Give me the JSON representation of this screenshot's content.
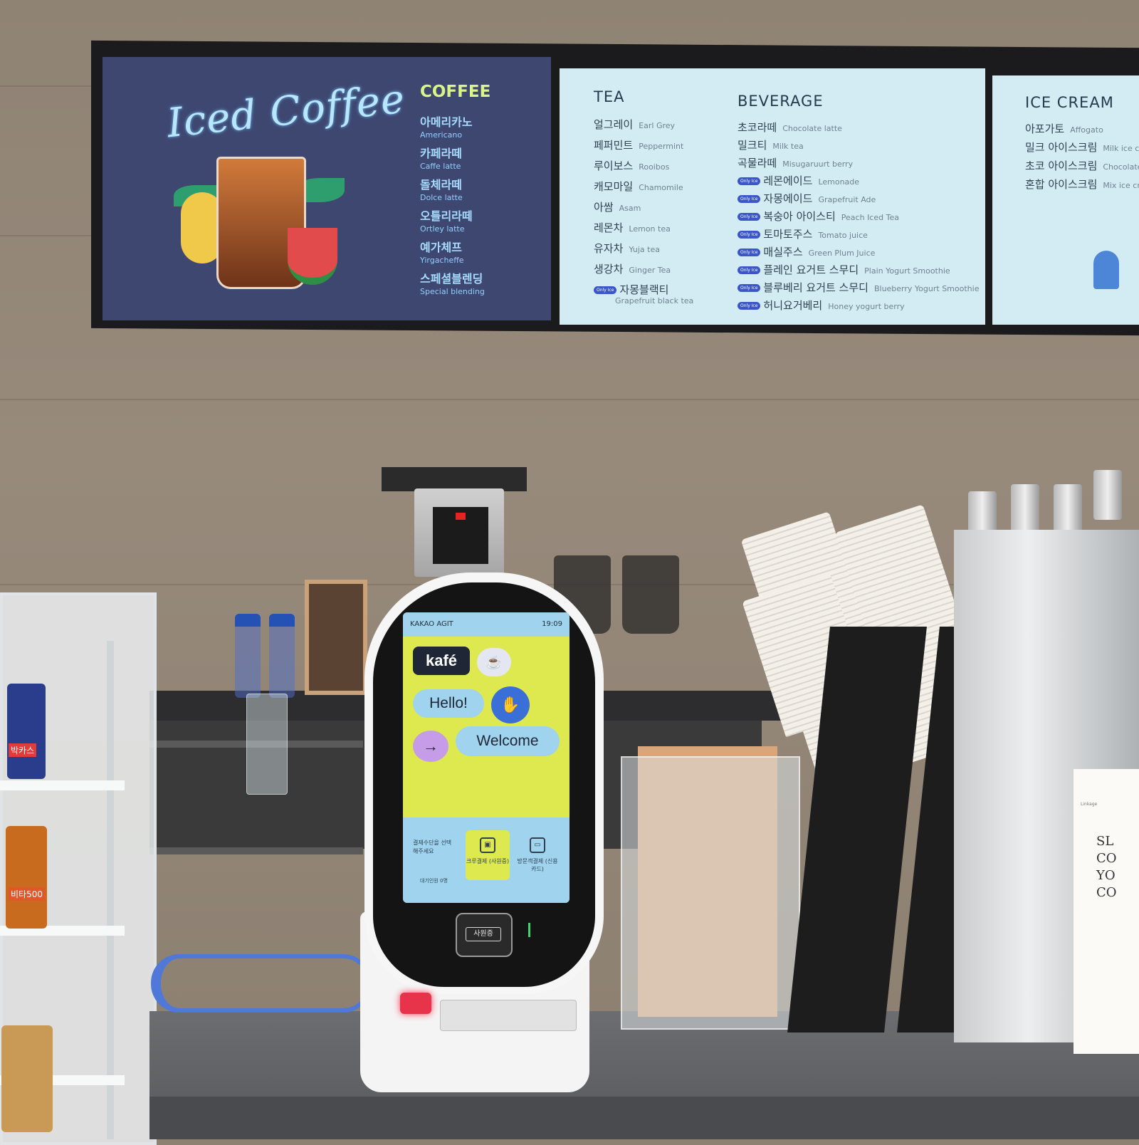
{
  "menu": {
    "coffee_panel": {
      "headline": "Iced Coffee",
      "category": "COFFEE",
      "items": [
        {
          "ko": "아메리카노",
          "en": "Americano"
        },
        {
          "ko": "카페라떼",
          "en": "Caffe latte"
        },
        {
          "ko": "돌체라떼",
          "en": "Dolce latte"
        },
        {
          "ko": "오틀리라떼",
          "en": "Ortley latte"
        },
        {
          "ko": "예가체프",
          "en": "Yirgacheffe"
        },
        {
          "ko": "스페셜블렌딩",
          "en": "Special blending"
        }
      ]
    },
    "tea_panel": {
      "category": "TEA",
      "items": [
        {
          "ko": "얼그레이",
          "en": "Earl Grey"
        },
        {
          "ko": "페퍼민트",
          "en": "Peppermint"
        },
        {
          "ko": "루이보스",
          "en": "Rooibos"
        },
        {
          "ko": "캐모마일",
          "en": "Chamomile"
        },
        {
          "ko": "아쌈",
          "en": "Asam"
        },
        {
          "ko": "레몬차",
          "en": "Lemon tea"
        },
        {
          "ko": "유자차",
          "en": "Yuja tea"
        },
        {
          "ko": "생강차",
          "en": "Ginger Tea"
        },
        {
          "ko": "자몽블랙티",
          "en": "Grapefruit black tea",
          "badge": "Only Ice"
        }
      ]
    },
    "beverage_panel": {
      "category": "BEVERAGE",
      "items": [
        {
          "ko": "초코라떼",
          "en": "Chocolate latte"
        },
        {
          "ko": "밀크티",
          "en": "Milk tea"
        },
        {
          "ko": "곡물라떼",
          "en": "Misugaruurt berry"
        },
        {
          "ko": "레몬에이드",
          "en": "Lemonade",
          "badge": "Only Ice"
        },
        {
          "ko": "자몽에이드",
          "en": "Grapefruit Ade",
          "badge": "Only Ice"
        },
        {
          "ko": "복숭아 아이스티",
          "en": "Peach Iced Tea",
          "badge": "Only Ice"
        },
        {
          "ko": "토마토주스",
          "en": "Tomato juice",
          "badge": "Only Ice"
        },
        {
          "ko": "매실주스",
          "en": "Green Plum Juice",
          "badge": "Only Ice"
        },
        {
          "ko": "플레인 요거트 스무디",
          "en": "Plain Yogurt Smoothie",
          "badge": "Only Ice"
        },
        {
          "ko": "블루베리 요거트 스무디",
          "en": "Blueberry Yogurt Smoothie",
          "badge": "Only Ice"
        },
        {
          "ko": "허니요거베리",
          "en": "Honey yogurt berry",
          "badge": "Only Ice"
        }
      ]
    },
    "icecream_panel": {
      "category": "ICE CREAM",
      "items": [
        {
          "ko": "아포가토",
          "en": "Affogato"
        },
        {
          "ko": "밀크 아이스크림",
          "en": "Milk ice cre"
        },
        {
          "ko": "초코 아이스크림",
          "en": "Chocolate i"
        },
        {
          "ko": "혼합 아이스크림",
          "en": "Mix ice crea"
        }
      ]
    }
  },
  "kiosk": {
    "brand": "KAKAO AGIT",
    "time": "19:09",
    "logo": "kafé",
    "greeting": "Hello!",
    "welcome": "Welcome",
    "payment_hint": "결제수단을 선택해주세요",
    "queue": "대기인원 0명",
    "options": [
      {
        "label": "크루결제 (사원증)",
        "icon": "badge-card-icon"
      },
      {
        "label": "방문객결제 (신용카드)",
        "icon": "credit-card-icon"
      }
    ],
    "reader_label": "사원증"
  },
  "scene": {
    "fridge_label_1": "박카스",
    "fridge_label_2": "비타500",
    "sign_lines": [
      "SL",
      "CO",
      "YO",
      "CO"
    ],
    "sign_small": "Linkage"
  },
  "colors": {
    "coffee_board": "#3e4770",
    "tea_board": "#d3ecf3",
    "kiosk_screen": "#dde94f",
    "kiosk_accent": "#9fd3ee"
  }
}
